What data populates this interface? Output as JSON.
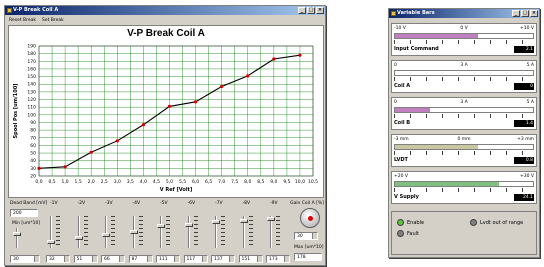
{
  "left_window": {
    "title": "V-P Break Coil A",
    "toolbar": {
      "reset_label": "Reset Break",
      "set_label": "Set Break"
    },
    "chart_title": "V-P Break Coil A",
    "ylabel": "Spool Pos [um/100]",
    "xlabel": "V Ref [Volt]"
  },
  "chart_data": {
    "type": "line",
    "title": "V-P Break Coil A",
    "xlabel": "V Ref [Volt]",
    "ylabel": "Spool Pos [um/100]",
    "xlim": [
      0,
      10
    ],
    "ylim": [
      20,
      190
    ],
    "x_ticks": [
      "0,0",
      "0,5",
      "1,0",
      "1,5",
      "2,0",
      "2,5",
      "3,0",
      "3,5",
      "4,0",
      "4,5",
      "5,0",
      "5,5",
      "6,0",
      "6,5",
      "7,0",
      "7,5",
      "8,0",
      "8,5",
      "9,0",
      "9,5",
      "10,0",
      "10,5"
    ],
    "y_ticks": [
      "20",
      "30",
      "40",
      "50",
      "60",
      "70",
      "80",
      "90",
      "100",
      "110",
      "120",
      "130",
      "140",
      "150",
      "160",
      "170",
      "180",
      "190"
    ],
    "grid": true,
    "series": [
      {
        "x": [
          0.0,
          1.0,
          2.0,
          3.0,
          4.0,
          5.0,
          6.0,
          7.0,
          8.0,
          9.0,
          10.0
        ],
        "y": [
          30,
          32,
          51,
          66,
          87,
          111,
          117,
          137,
          151,
          173,
          178
        ]
      }
    ]
  },
  "controls": {
    "dead_band_label": "Dead Band [mV]",
    "dead_band_value": "200",
    "min_label": "Min [um*10]",
    "min_value": "30",
    "gain_label": "Gain Coil A [%]",
    "gain_value": "30",
    "max_label": "Max [um*10]",
    "max_value": "178",
    "slider_labels": [
      "-1V",
      "-2V",
      "-3V",
      "-4V",
      "-5V",
      "-6V",
      "-7V",
      "-8V",
      "-9V"
    ],
    "slider_values": [
      "32",
      "51",
      "66",
      "87",
      "111",
      "117",
      "137",
      "151",
      "173"
    ],
    "slider_levels": [
      0.15,
      0.3,
      0.4,
      0.5,
      0.7,
      0.75,
      0.85,
      0.9,
      0.95
    ]
  },
  "right_window": {
    "title": "Variable Bars",
    "groups": [
      {
        "name": "Input Command",
        "scale_left": "-10 V",
        "scale_mid": "0 V",
        "scale_right": "+10 V",
        "value": "2.1",
        "fill_color": "#c080c0",
        "fill_start": 0,
        "fill_end": 0.6
      },
      {
        "name": "Coil A",
        "scale_left": "0",
        "scale_mid": "3 A",
        "scale_right": "5 A",
        "value": "0",
        "fill_color": "#c080c0",
        "fill_start": 0,
        "fill_end": 0
      },
      {
        "name": "Coil B",
        "scale_left": "0",
        "scale_mid": "3 A",
        "scale_right": "5 A",
        "value": "1.4",
        "fill_color": "#c080c0",
        "fill_start": 0,
        "fill_end": 0.25
      },
      {
        "name": "LVDT",
        "scale_left": "-3 mm",
        "scale_mid": "0 mm",
        "scale_right": "+3 mm",
        "value": "0.8",
        "fill_color": "#c8c8a0",
        "fill_start": 0,
        "fill_end": 0.6
      },
      {
        "name": "V Supply",
        "scale_left": "+20 V",
        "scale_mid": "",
        "scale_right": "+30 V",
        "value": "24.1",
        "fill_color": "#80c080",
        "fill_start": 0,
        "fill_end": 0.75
      }
    ],
    "leds": [
      {
        "label": "Enable",
        "color": "#60c040"
      },
      {
        "label": "Lvdt out of range",
        "color": "#808080"
      },
      {
        "label": "Fault",
        "color": "#808080"
      }
    ]
  }
}
